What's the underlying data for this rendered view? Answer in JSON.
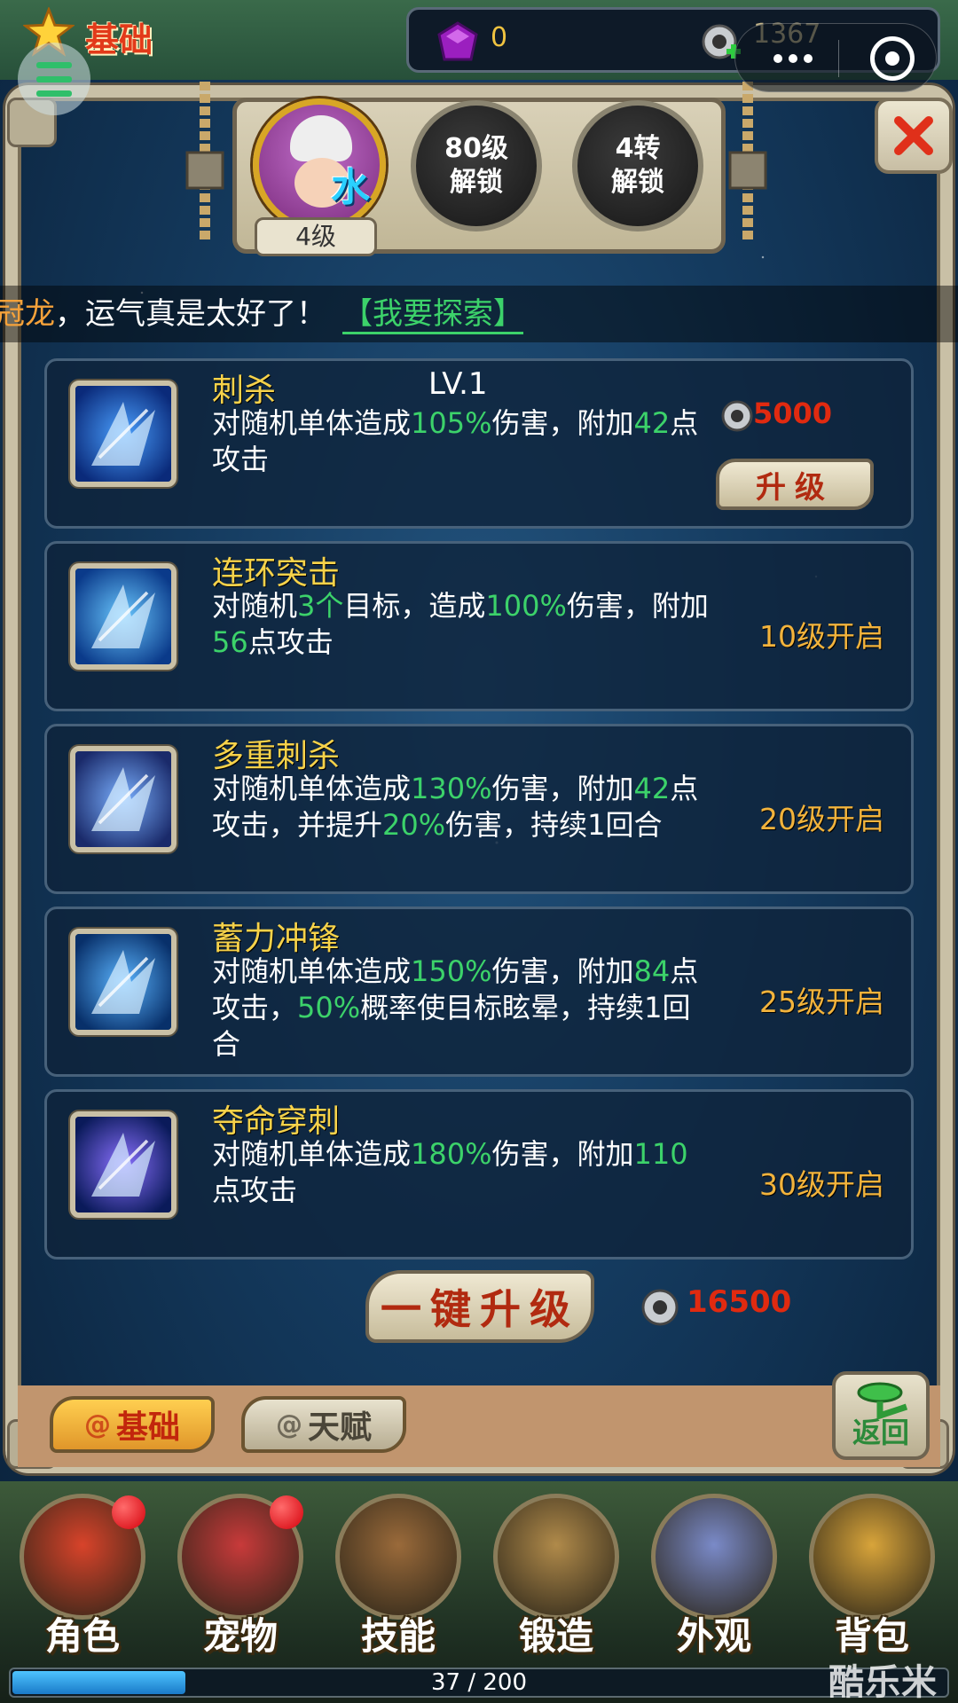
{
  "header": {
    "title": "基础",
    "gem_value": "0",
    "coin_value": "1367"
  },
  "hero": {
    "element": "水",
    "level_label": "4级",
    "locks": [
      {
        "line1": "80级",
        "line2": "解锁"
      },
      {
        "line1": "4转",
        "line2": "解锁"
      }
    ]
  },
  "notice": {
    "name": "冠龙",
    "message": "，运气真是太好了！",
    "link": "【我要探索】"
  },
  "skills": [
    {
      "name": "刺杀",
      "level": "LV.1",
      "desc": [
        [
          "对随机单体造成",
          false
        ],
        [
          "105%",
          true
        ],
        [
          "伤害，附加",
          false
        ],
        [
          "42",
          true
        ],
        [
          "点攻击",
          false
        ]
      ],
      "cost": "5000",
      "button": "升级"
    },
    {
      "name": "连环突击",
      "desc": [
        [
          "对随机",
          false
        ],
        [
          "3个",
          true
        ],
        [
          "目标，造成",
          false
        ],
        [
          "100%",
          true
        ],
        [
          "伤害，附加",
          false
        ],
        [
          "56",
          true
        ],
        [
          "点攻击",
          false
        ]
      ],
      "unlock": "10级开启"
    },
    {
      "name": "多重刺杀",
      "desc": [
        [
          "对随机单体造成",
          false
        ],
        [
          "130%",
          true
        ],
        [
          "伤害，附加",
          false
        ],
        [
          "42",
          true
        ],
        [
          "点攻击，并提升",
          false
        ],
        [
          "20%",
          true
        ],
        [
          "伤害，持续1回合",
          false
        ]
      ],
      "unlock": "20级开启"
    },
    {
      "name": "蓄力冲锋",
      "desc": [
        [
          "对随机单体造成",
          false
        ],
        [
          "150%",
          true
        ],
        [
          "伤害，附加",
          false
        ],
        [
          "84",
          true
        ],
        [
          "点攻击，",
          false
        ],
        [
          "50%",
          true
        ],
        [
          "概率使目标眩晕，持续1回合",
          false
        ]
      ],
      "unlock": "25级开启"
    },
    {
      "name": "夺命穿刺",
      "desc": [
        [
          "对随机单体造成",
          false
        ],
        [
          "180%",
          true
        ],
        [
          "伤害，附加",
          false
        ],
        [
          "110",
          true
        ],
        [
          "点攻击",
          false
        ]
      ],
      "unlock": "30级开启"
    }
  ],
  "one_key": {
    "label": "一键升级",
    "cost": "16500"
  },
  "tabs": {
    "basic": "基础",
    "talent": "天赋",
    "back": "返回"
  },
  "nav": [
    {
      "label": "角色",
      "badge": true
    },
    {
      "label": "宠物",
      "badge": true
    },
    {
      "label": "技能",
      "badge": false
    },
    {
      "label": "锻造",
      "badge": false
    },
    {
      "label": "外观",
      "badge": false
    },
    {
      "label": "背包",
      "badge": false
    }
  ],
  "progress": {
    "current": 37,
    "max": 200,
    "text": "37 / 200"
  },
  "watermark": "酷乐米",
  "colors": {
    "highlight": "#3cd26a",
    "unlock": "#f2b33c",
    "cost": "#e02a10",
    "skill_name": "#f6d24a"
  }
}
